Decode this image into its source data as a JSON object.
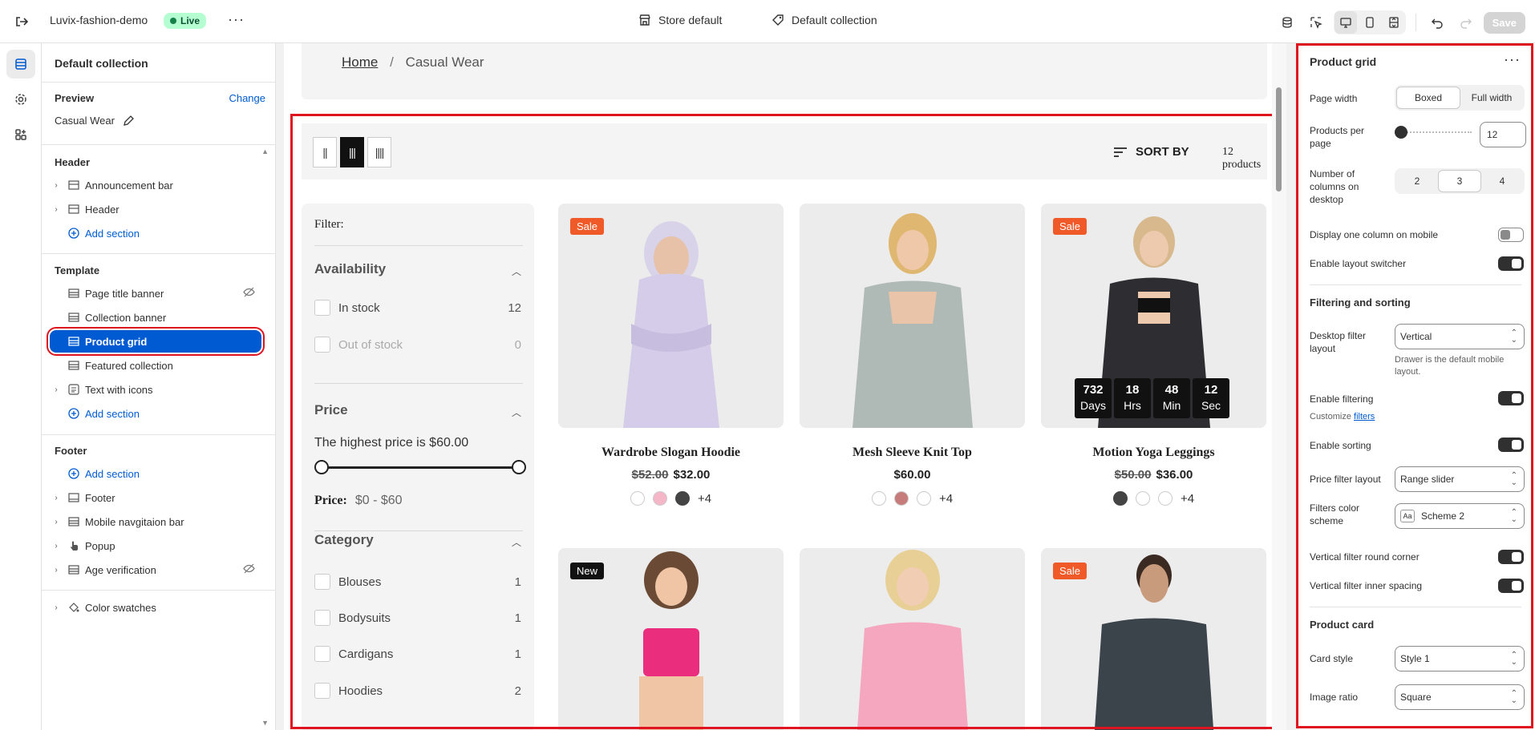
{
  "topbar": {
    "store_name": "Luvix-fashion-demo",
    "live_badge": "Live",
    "more": "···",
    "theme_label": "Store default",
    "template_label": "Default collection",
    "save_label": "Save"
  },
  "left_panel": {
    "title": "Default collection",
    "preview_label": "Preview",
    "change_label": "Change",
    "preview_value": "Casual Wear",
    "header_section": "Header",
    "header_items": [
      "Announcement bar",
      "Header"
    ],
    "add_section": "Add section",
    "template_section": "Template",
    "template_items": [
      "Page title banner",
      "Collection banner",
      "Product grid",
      "Featured collection",
      "Text with icons"
    ],
    "footer_section": "Footer",
    "footer_items": [
      "Footer",
      "Mobile navgitaion bar",
      "Popup",
      "Age verification"
    ],
    "color_swatches": "Color swatches"
  },
  "preview": {
    "breadcrumb_home": "Home",
    "breadcrumb_sep": "/",
    "breadcrumb_current": "Casual Wear",
    "sort_by": "SORT BY",
    "product_count": "12 products",
    "filter": {
      "title": "Filter:",
      "availability": "Availability",
      "in_stock": "In stock",
      "in_stock_count": "12",
      "out_of_stock": "Out of stock",
      "out_of_stock_count": "0",
      "price": "Price",
      "highest_price": "The highest price is $60.00",
      "price_label": "Price:",
      "price_range": "$0 - $60",
      "category": "Category",
      "categories": [
        {
          "label": "Blouses",
          "count": "1"
        },
        {
          "label": "Bodysuits",
          "count": "1"
        },
        {
          "label": "Cardigans",
          "count": "1"
        },
        {
          "label": "Hoodies",
          "count": "2"
        }
      ]
    },
    "products": [
      {
        "name": "Wardrobe Slogan Hoodie",
        "old_price": "$52.00",
        "price": "$32.00",
        "badge": "Sale",
        "more": "+4"
      },
      {
        "name": "Mesh Sleeve Knit Top",
        "old_price": "",
        "price": "$60.00",
        "badge": "",
        "more": "+4"
      },
      {
        "name": "Motion Yoga Leggings",
        "old_price": "$50.00",
        "price": "$36.00",
        "badge": "Sale",
        "more": "+4"
      },
      {
        "name": "",
        "old_price": "",
        "price": "",
        "badge": "New",
        "more": ""
      },
      {
        "name": "",
        "old_price": "",
        "price": "",
        "badge": "",
        "more": ""
      },
      {
        "name": "",
        "old_price": "",
        "price": "",
        "badge": "Sale",
        "more": ""
      }
    ],
    "countdown": [
      {
        "value": "732",
        "unit": "Days"
      },
      {
        "value": "18",
        "unit": "Hrs"
      },
      {
        "value": "48",
        "unit": "Min"
      },
      {
        "value": "12",
        "unit": "Sec"
      }
    ]
  },
  "right_panel": {
    "title": "Product grid",
    "page_width": "Page width",
    "boxed": "Boxed",
    "full_width": "Full width",
    "products_per_page": "Products per page",
    "products_per_page_value": "12",
    "columns_label": "Number of columns on desktop",
    "col_options": [
      "2",
      "3",
      "4"
    ],
    "one_column_mobile": "Display one column on mobile",
    "layout_switcher": "Enable layout switcher",
    "filtering_sorting": "Filtering and sorting",
    "desktop_filter_layout": "Desktop filter layout",
    "desktop_filter_value": "Vertical",
    "drawer_help": "Drawer is the default mobile layout.",
    "enable_filtering": "Enable filtering",
    "customize": "Customize",
    "filters_link": "filters",
    "enable_sorting": "Enable sorting",
    "price_filter_layout": "Price filter layout",
    "price_filter_value": "Range slider",
    "filters_color_scheme": "Filters color scheme",
    "scheme_value": "Scheme 2",
    "scheme_icon_text": "Aa",
    "round_corner": "Vertical filter round corner",
    "inner_spacing": "Vertical filter inner spacing",
    "product_card": "Product card",
    "card_style": "Card style",
    "card_style_value": "Style 1",
    "image_ratio": "Image ratio",
    "image_ratio_value": "Square"
  },
  "colors": {
    "accent": "#005bd3",
    "highlight": "#e0141e",
    "sale": "#f05a28",
    "live": "#b4fed2"
  }
}
